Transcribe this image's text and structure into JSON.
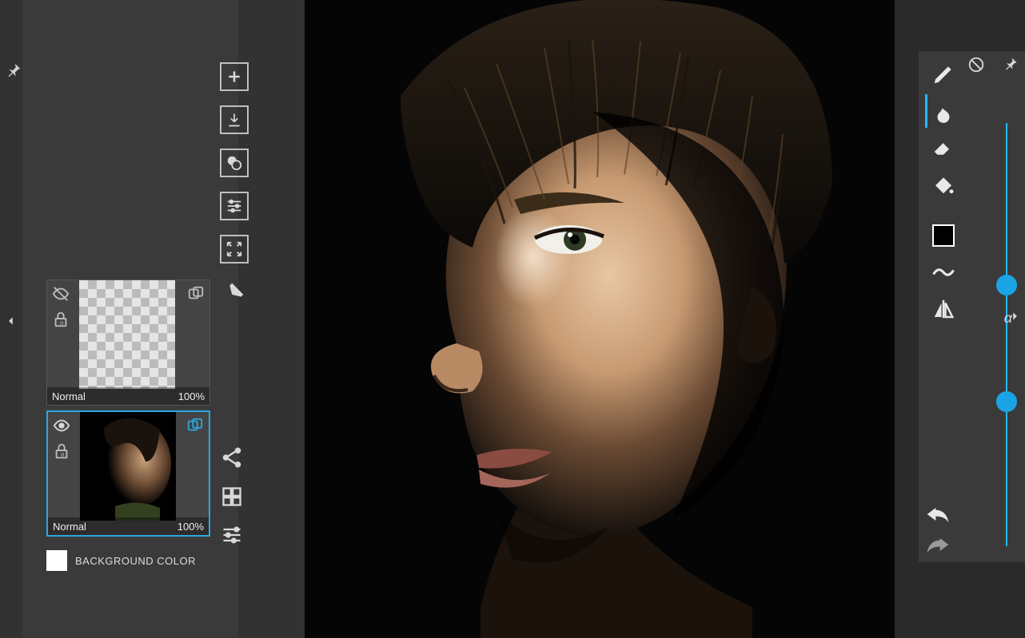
{
  "left_panel": {
    "buttons": {
      "add": "add-layer",
      "merge_down": "merge-down",
      "layer_fx": "layer-shapes",
      "adjust": "adjustments",
      "transform": "transform",
      "clear": "clear-layer"
    },
    "layers": [
      {
        "blend_mode": "Normal",
        "opacity": "100%",
        "visible": false,
        "locked_alpha": true,
        "selected": false,
        "thumb": "transparent"
      },
      {
        "blend_mode": "Normal",
        "opacity": "100%",
        "visible": true,
        "locked_alpha": true,
        "selected": true,
        "thumb": "portrait"
      }
    ],
    "background_label": "BACKGROUND COLOR",
    "background_color": "#ffffff",
    "lower_buttons": {
      "share": "share",
      "grid": "thumbnails-grid",
      "sliders": "settings-sliders"
    }
  },
  "right_panel": {
    "tools": [
      {
        "name": "pen-tool",
        "selected": false
      },
      {
        "name": "smudge-tool",
        "selected": true
      },
      {
        "name": "eraser-tool",
        "selected": false
      },
      {
        "name": "fill-bucket-tool",
        "selected": false
      }
    ],
    "color_swatch": "#000000",
    "color_swatch_border": "#ffffff",
    "extras": [
      {
        "name": "wave-tool"
      },
      {
        "name": "symmetry-tool"
      }
    ],
    "alpha_label": "α",
    "slider1_value": 0.37,
    "slider2_value": 0.64,
    "no_entry": "disable",
    "pin": "pin"
  },
  "canvas": {
    "content": "portrait-painting"
  }
}
